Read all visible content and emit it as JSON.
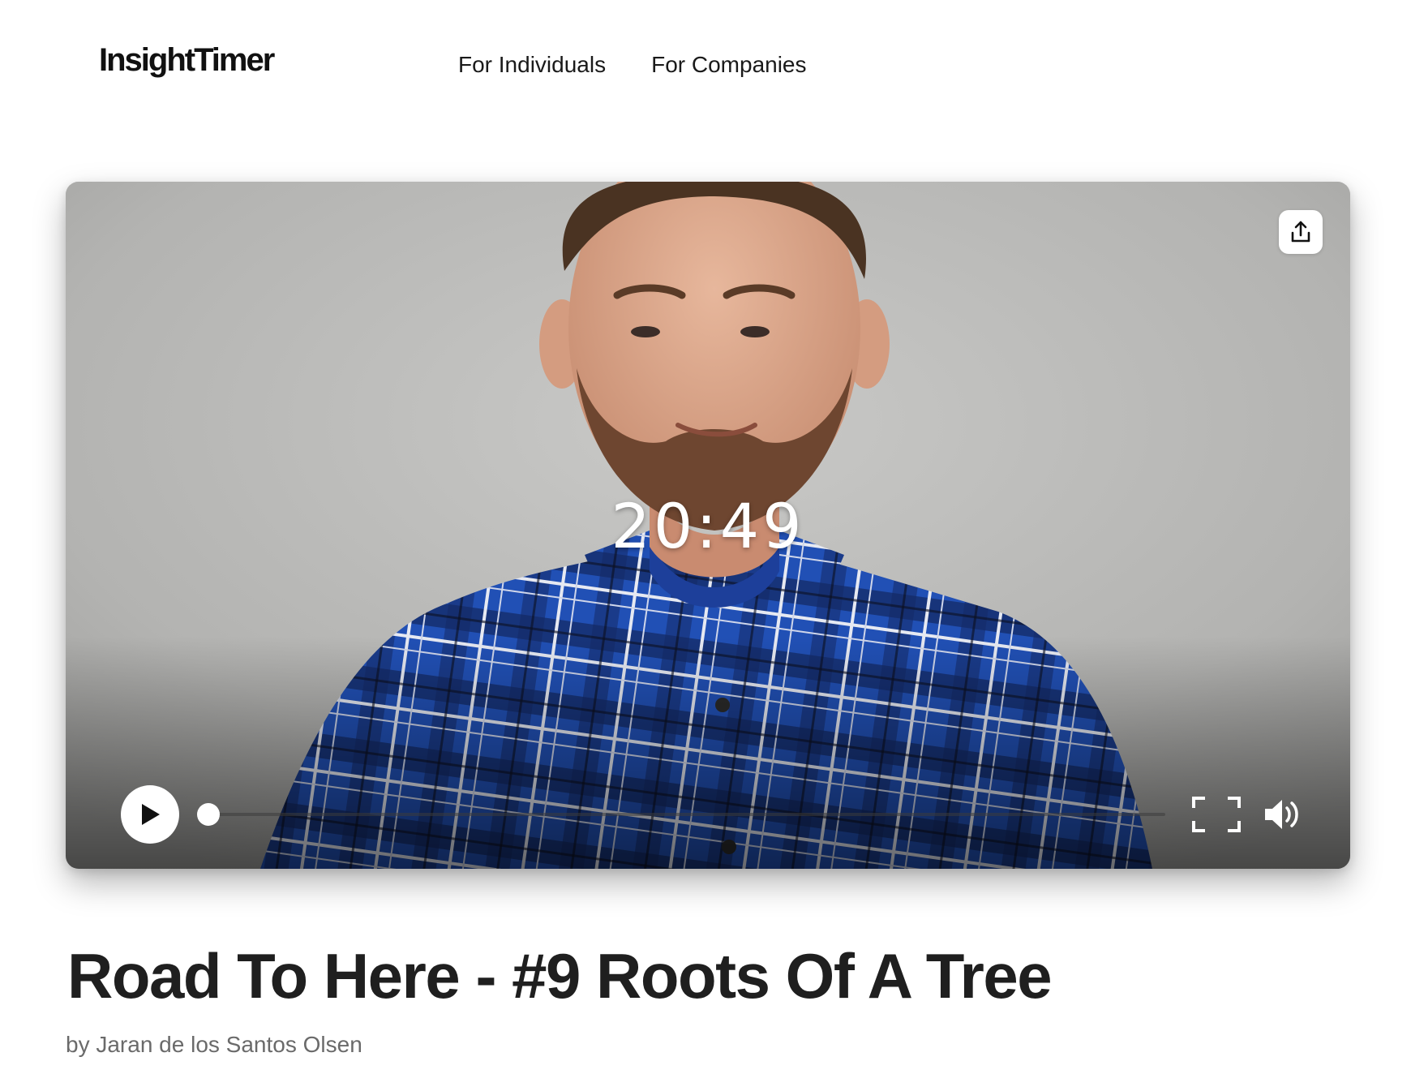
{
  "header": {
    "logo_text": "InsightTimer",
    "nav": [
      {
        "label": "For Individuals"
      },
      {
        "label": "For Companies"
      }
    ]
  },
  "player": {
    "time_display": "20:49",
    "progress_fraction": 0.0,
    "icons": {
      "share": "share-icon",
      "play": "play-icon",
      "fullscreen": "fullscreen-icon",
      "volume": "volume-icon"
    }
  },
  "content": {
    "title": "Road To Here - #9 Roots Of A Tree",
    "author": "by Jaran de los Santos Olsen"
  },
  "colors": {
    "shirt_blue": "#1f4fb0",
    "title_text": "#1f1f1f",
    "author_text": "#6a6a6a"
  }
}
